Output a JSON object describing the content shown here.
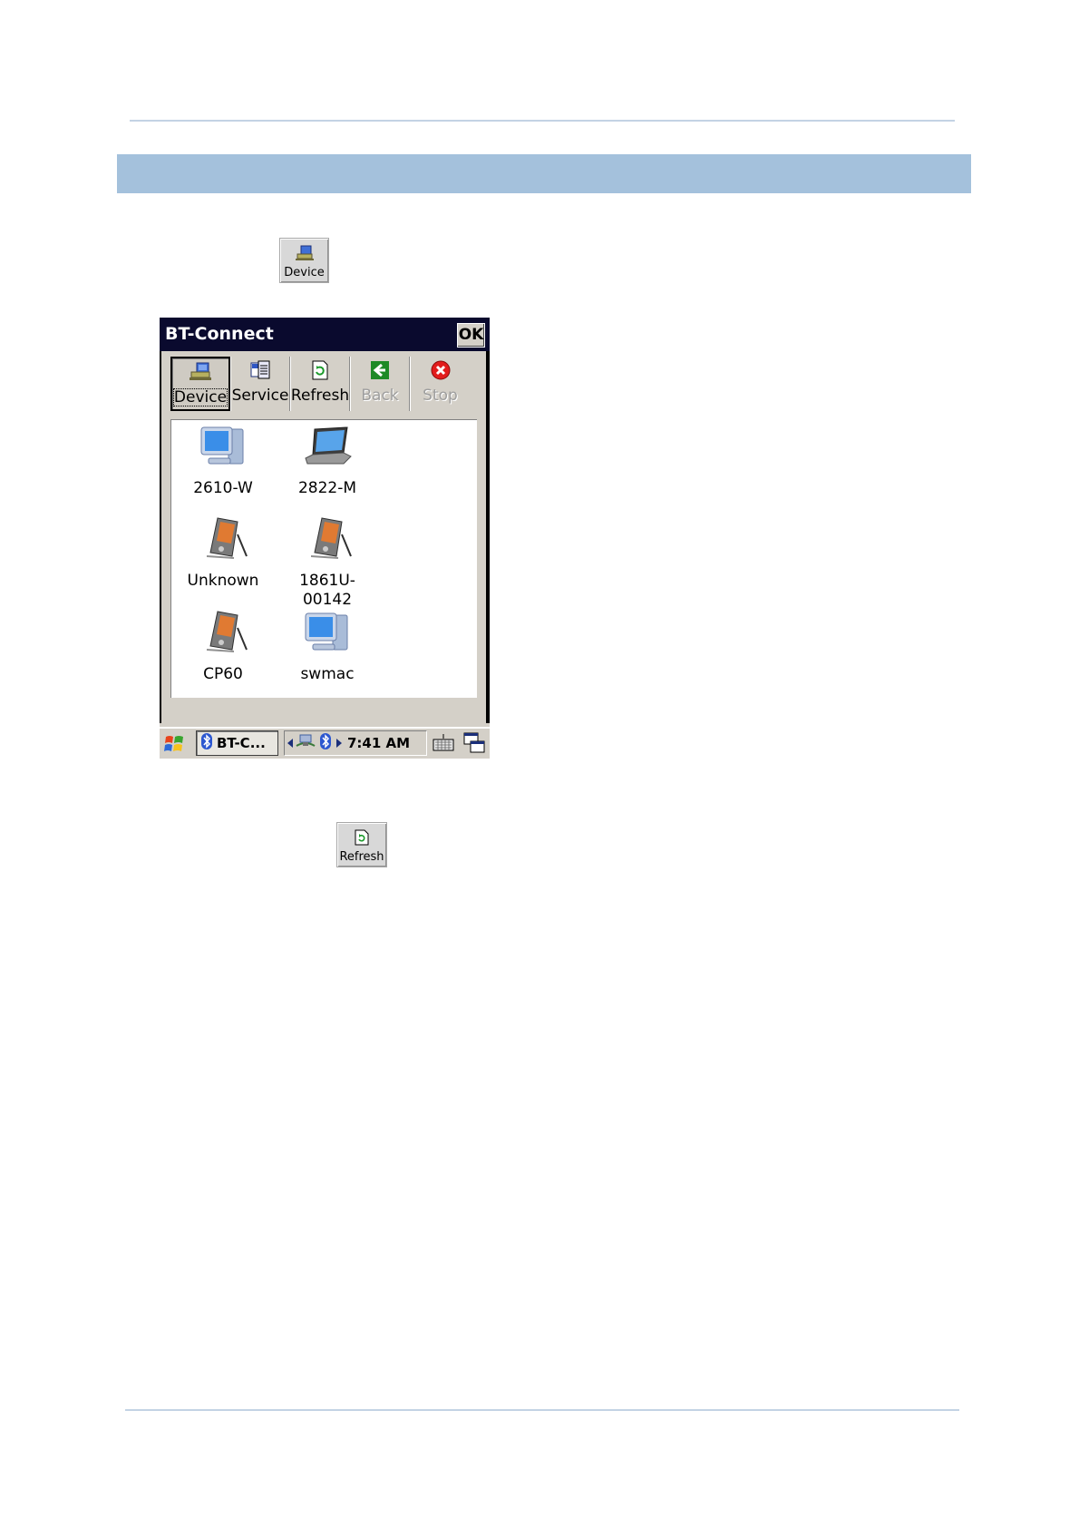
{
  "page": {
    "inline_buttons": {
      "device_label": "Device",
      "refresh_label": "Refresh"
    }
  },
  "window": {
    "title": "BT-Connect",
    "ok_label": "OK"
  },
  "toolbar": {
    "buttons": [
      {
        "label": "Device",
        "icon": "device-icon",
        "state": "pressed"
      },
      {
        "label": "Service",
        "icon": "service-icon",
        "state": "normal"
      },
      {
        "label": "Refresh",
        "icon": "refresh-icon",
        "state": "normal"
      },
      {
        "label": "Back",
        "icon": "back-arrow-icon",
        "state": "disabled"
      },
      {
        "label": "Stop",
        "icon": "stop-icon",
        "state": "disabled"
      }
    ]
  },
  "devices": [
    {
      "name": "2610-W",
      "icon": "desktop-computer-icon"
    },
    {
      "name": "2822-M",
      "icon": "laptop-icon"
    },
    {
      "name": "Unknown",
      "icon": "pda-icon"
    },
    {
      "name": "1861U-\n00142",
      "line1": "1861U-",
      "line2": "00142",
      "icon": "pda-icon"
    },
    {
      "name": "CP60",
      "icon": "pda-icon"
    },
    {
      "name": "swmac",
      "icon": "desktop-computer-icon"
    }
  ],
  "taskbar": {
    "task_label": "BT-C...",
    "clock": "7:41 AM"
  },
  "colors": {
    "section_band": "#a4c1dc",
    "rule": "#c3d3e4",
    "titlebar": "#0a0a2e",
    "chrome": "#d4d0c8"
  }
}
